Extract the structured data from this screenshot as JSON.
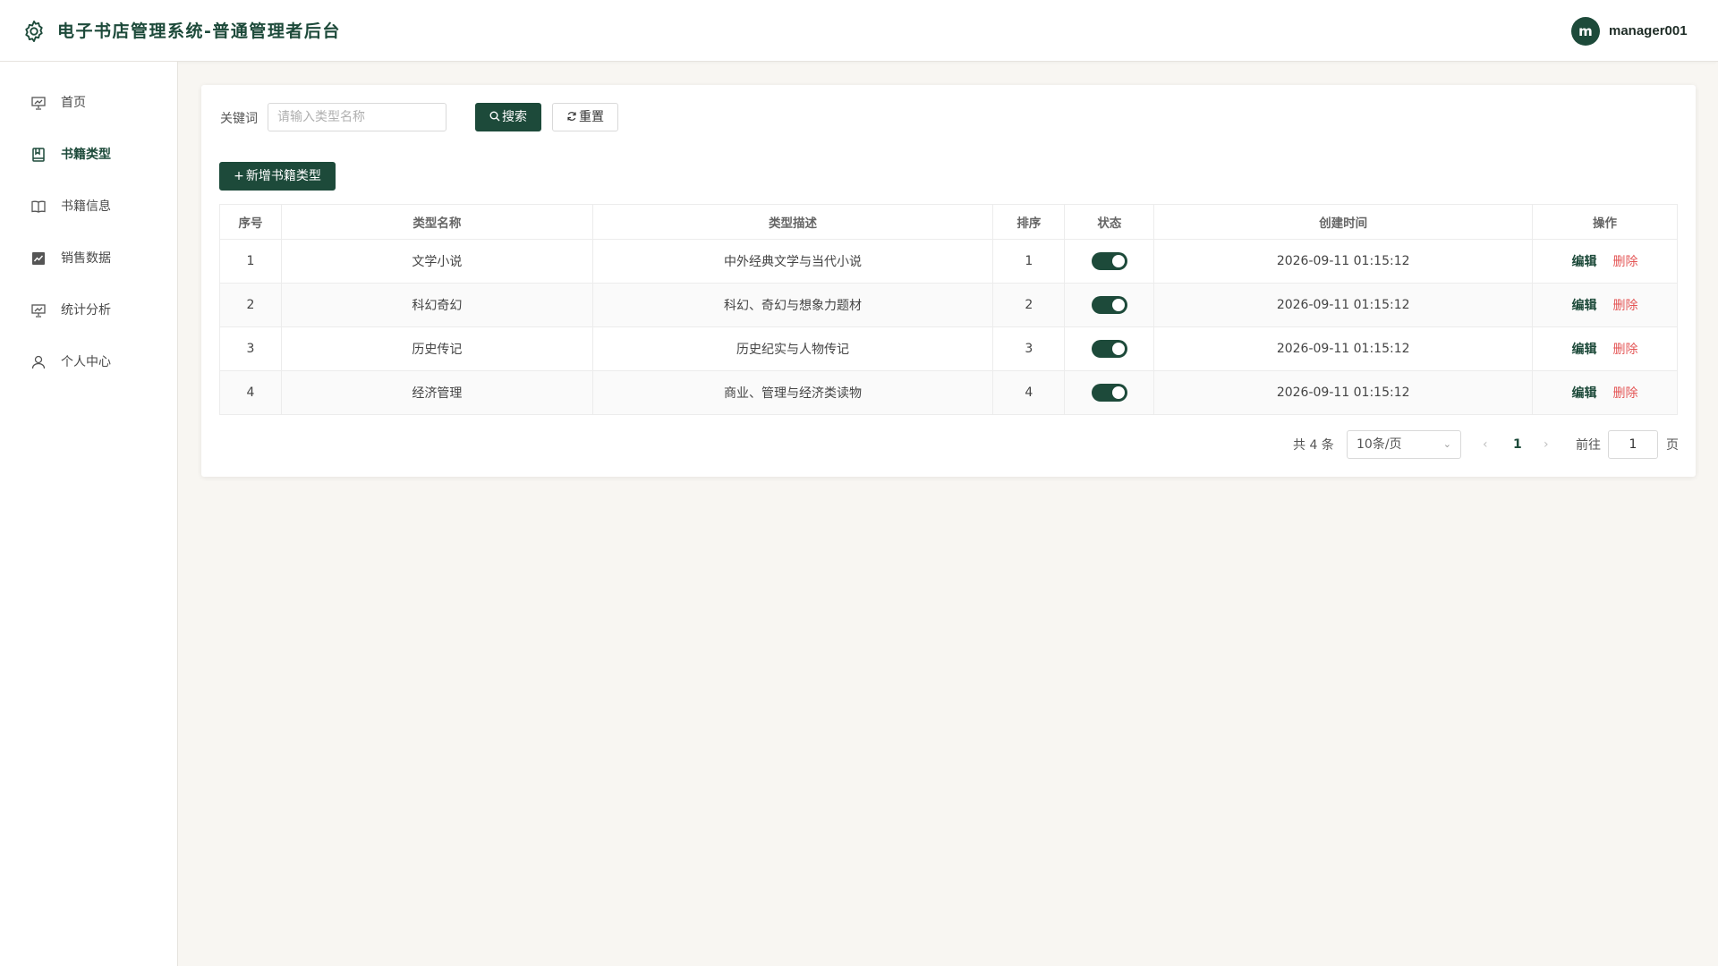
{
  "header": {
    "title": "电子书店管理系统-普通管理者后台",
    "avatar_letter": "m",
    "username": "manager001"
  },
  "sidebar": {
    "items": [
      {
        "label": "首页",
        "icon": "presentation-icon",
        "active": false
      },
      {
        "label": "书籍类型",
        "icon": "book-icon",
        "active": true
      },
      {
        "label": "书籍信息",
        "icon": "open-book-icon",
        "active": false
      },
      {
        "label": "销售数据",
        "icon": "chart-icon",
        "active": false
      },
      {
        "label": "统计分析",
        "icon": "presentation-icon",
        "active": false
      },
      {
        "label": "个人中心",
        "icon": "user-icon",
        "active": false
      }
    ]
  },
  "search": {
    "label": "关键词",
    "placeholder": "请输入类型名称",
    "value": "",
    "search_button": "搜索",
    "reset_button": "重置"
  },
  "add_button": "新增书籍类型",
  "table": {
    "columns": [
      "序号",
      "类型名称",
      "类型描述",
      "排序",
      "状态",
      "创建时间",
      "操作"
    ],
    "rows": [
      {
        "index": "1",
        "name": "文学小说",
        "desc": "中外经典文学与当代小说",
        "sort": "1",
        "status": true,
        "created": "2026-09-11 01:15:12"
      },
      {
        "index": "2",
        "name": "科幻奇幻",
        "desc": "科幻、奇幻与想象力题材",
        "sort": "2",
        "status": true,
        "created": "2026-09-11 01:15:12"
      },
      {
        "index": "3",
        "name": "历史传记",
        "desc": "历史纪实与人物传记",
        "sort": "3",
        "status": true,
        "created": "2026-09-11 01:15:12"
      },
      {
        "index": "4",
        "name": "经济管理",
        "desc": "商业、管理与经济类读物",
        "sort": "4",
        "status": true,
        "created": "2026-09-11 01:15:12"
      }
    ],
    "edit_label": "编辑",
    "delete_label": "删除"
  },
  "pagination": {
    "total_text": "共 4 条",
    "page_size": "10条/页",
    "current_page": "1",
    "goto_label": "前往",
    "goto_value": "1",
    "goto_suffix": "页"
  },
  "colors": {
    "primary": "#1d4a3a",
    "danger": "#e45656",
    "background": "#f8f6f2"
  }
}
